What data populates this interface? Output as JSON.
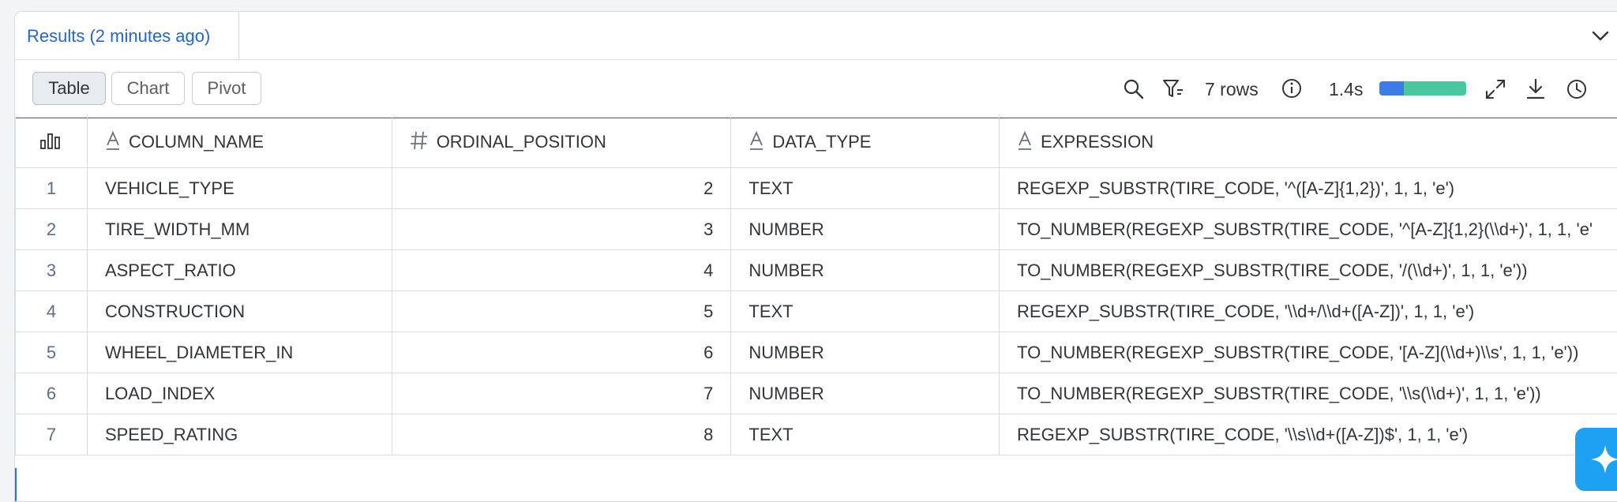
{
  "results_tab": {
    "label": "Results",
    "age": "(2 minutes ago)"
  },
  "view_tabs": [
    "Table",
    "Chart",
    "Pivot"
  ],
  "active_view": "Table",
  "status": {
    "rows_label": "7 rows",
    "duration": "1.4s"
  },
  "table": {
    "columns": [
      {
        "type_icon": "text-type-icon",
        "label": "COLUMN_NAME"
      },
      {
        "type_icon": "hash-type-icon",
        "label": "ORDINAL_POSITION"
      },
      {
        "type_icon": "text-type-icon",
        "label": "DATA_TYPE"
      },
      {
        "type_icon": "text-type-icon",
        "label": "EXPRESSION"
      }
    ],
    "rows": [
      {
        "idx": "1",
        "column_name": "VEHICLE_TYPE",
        "ordinal": "2",
        "data_type": "TEXT",
        "expression": "REGEXP_SUBSTR(TIRE_CODE, '^([A-Z]{1,2})', 1, 1, 'e')"
      },
      {
        "idx": "2",
        "column_name": "TIRE_WIDTH_MM",
        "ordinal": "3",
        "data_type": "NUMBER",
        "expression": "TO_NUMBER(REGEXP_SUBSTR(TIRE_CODE, '^[A-Z]{1,2}(\\\\d+)', 1, 1, 'e'"
      },
      {
        "idx": "3",
        "column_name": "ASPECT_RATIO",
        "ordinal": "4",
        "data_type": "NUMBER",
        "expression": "TO_NUMBER(REGEXP_SUBSTR(TIRE_CODE, '/(\\\\d+)', 1, 1, 'e'))"
      },
      {
        "idx": "4",
        "column_name": "CONSTRUCTION",
        "ordinal": "5",
        "data_type": "TEXT",
        "expression": "REGEXP_SUBSTR(TIRE_CODE, '\\\\d+/\\\\d+([A-Z])', 1, 1, 'e')"
      },
      {
        "idx": "5",
        "column_name": "WHEEL_DIAMETER_IN",
        "ordinal": "6",
        "data_type": "NUMBER",
        "expression": "TO_NUMBER(REGEXP_SUBSTR(TIRE_CODE, '[A-Z](\\\\d+)\\\\s', 1, 1, 'e'))"
      },
      {
        "idx": "6",
        "column_name": "LOAD_INDEX",
        "ordinal": "7",
        "data_type": "NUMBER",
        "expression": "TO_NUMBER(REGEXP_SUBSTR(TIRE_CODE, '\\\\s(\\\\d+)', 1, 1, 'e'))"
      },
      {
        "idx": "7",
        "column_name": "SPEED_RATING",
        "ordinal": "8",
        "data_type": "TEXT",
        "expression": "REGEXP_SUBSTR(TIRE_CODE, '\\\\s\\\\d+([A-Z])$', 1, 1, 'e')"
      }
    ]
  },
  "colors": {
    "accent": "#2366d1",
    "progress_a": "#3b7ce6",
    "progress_b": "#49c8a0",
    "fab": "#1da1f2"
  }
}
